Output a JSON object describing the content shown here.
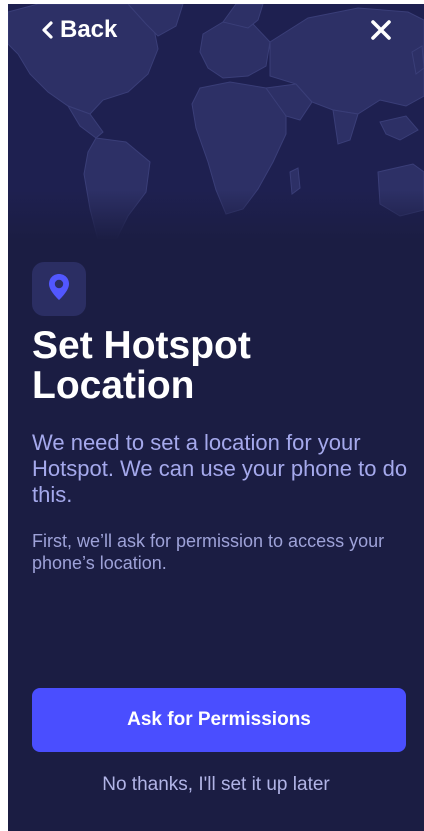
{
  "header": {
    "back_label": "Back",
    "back_icon": "chevron-left-icon",
    "close_icon": "close-icon"
  },
  "hero": {
    "image": "world-map-illustration",
    "icon": "location-pin-icon"
  },
  "content": {
    "title": "Set Hotspot Location",
    "intro": "We need to set a location for your Hotspot. We can use your phone to do this.",
    "detail": "First, we’ll ask for permission to access your phone’s location."
  },
  "actions": {
    "primary_label": "Ask for Permissions",
    "secondary_label": "No thanks, I'll set it up later"
  },
  "colors": {
    "background": "#1b1d43",
    "map": "#2a2d60",
    "accent": "#4a4eff",
    "body_text": "#a5a9ec",
    "icon_tile": "#2b2e63"
  }
}
